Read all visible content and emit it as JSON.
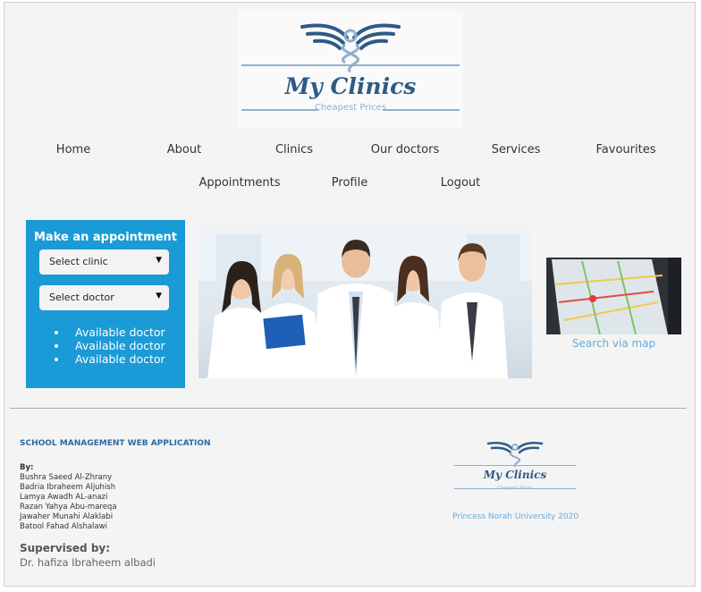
{
  "brand": {
    "name": "My Clinics",
    "tagline": "Cheapest Prices"
  },
  "nav": {
    "row1": [
      "Home",
      "About",
      "Clinics",
      "Our doctors",
      "Services",
      "Favourites"
    ],
    "row2": [
      "Appointments",
      "Profile",
      "Logout"
    ]
  },
  "appointment": {
    "title": "Make an appointment",
    "clinic_select": "Select clinic",
    "doctor_select": "Select doctor",
    "doctors": [
      "Available doctor",
      "Available doctor",
      "Available doctor"
    ]
  },
  "map": {
    "link_label": "Search via map"
  },
  "footer": {
    "title": "SCHOOL MANAGEMENT WEB APPLICATION",
    "by_label": "By:",
    "authors": [
      "Bushra Saeed Al-Zhrany",
      "Badria Ibraheem Aljuhish",
      "Lamya Awadh AL-anazi",
      "Razan Yahya Abu-mareqa",
      "Jawaher Munahi Alaklabi",
      "Batool Fahad Alshalawi"
    ],
    "supervised_label": "Supervised by:",
    "supervisor": "Dr. hafiza Ibraheem albadi",
    "university": "Princess Norah University 2020"
  },
  "colors": {
    "brand_dark": "#2d5b86",
    "brand_light": "#8fb0cf",
    "panel_blue": "#1a9ad6",
    "link_blue": "#6aa9d8"
  }
}
